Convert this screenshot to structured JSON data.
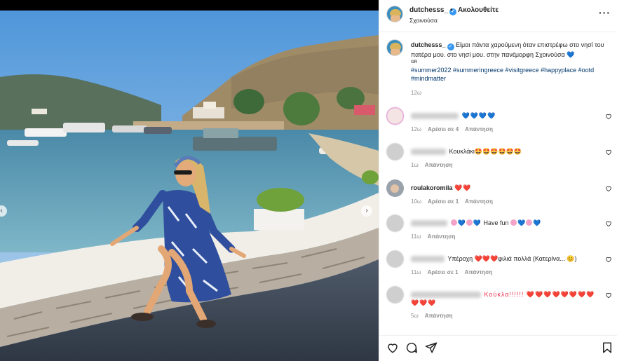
{
  "header": {
    "username": "dutchesss_",
    "separator": "•",
    "follow_label": "Ακολουθείτε",
    "location": "Σχοινούσα",
    "more_label": "···"
  },
  "caption": {
    "username": "dutchesss_",
    "text": "Είμαι πάντα χαρούμενη όταν επιστρέφω στο νησί του πατέρα μου. στο νησί μου. στην πανέμορφη Σχοινούσα",
    "heart": "💙",
    "flag_label": "GR",
    "hashtags": "#summer2022 #summeringreece #visitgreece #happyplace #ootd #mindmatter",
    "time": "12ω"
  },
  "comments": [
    {
      "username": "",
      "text": "💙💙💙💙",
      "time": "12ω",
      "likes": "Αρέσει σε 4",
      "reply": "Απάντηση"
    },
    {
      "username": "",
      "text": "Κουκλάκι🤩🤩🤩🤩🤩🤩",
      "time": "1ω",
      "likes": "",
      "reply": "Απάντηση"
    },
    {
      "username": "roulakoromila",
      "text": "❤️❤️",
      "time": "10ω",
      "likes": "Αρέσει σε 1",
      "reply": "Απάντηση"
    },
    {
      "username": "",
      "text": "Have fun",
      "time": "11ω",
      "likes": "",
      "reply": "Απάντηση"
    },
    {
      "username": "",
      "text": "Υπέροχη ❤️❤️❤️φιλιά πολλά (Κατερίνα... 😊)",
      "time": "11ω",
      "likes": "Αρέσει σε 1",
      "reply": "Απάντηση"
    },
    {
      "username": "",
      "text": "Κούκλα!!!!!! ❤️❤️❤️❤️❤️❤️❤️❤️❤️❤️❤️",
      "time": "5ω",
      "likes": "",
      "reply": "Απάντηση"
    }
  ],
  "icons": [
    "like-icon",
    "comment-icon",
    "share-icon",
    "save-icon",
    "more-icon",
    "heart-icon",
    "verified-icon",
    "chevron-left-icon",
    "chevron-right-icon"
  ],
  "colors": {
    "link": "#00376b",
    "verified": "#3897f0",
    "muted": "#8e8e8e",
    "heart_red": "#ed2d4a"
  }
}
